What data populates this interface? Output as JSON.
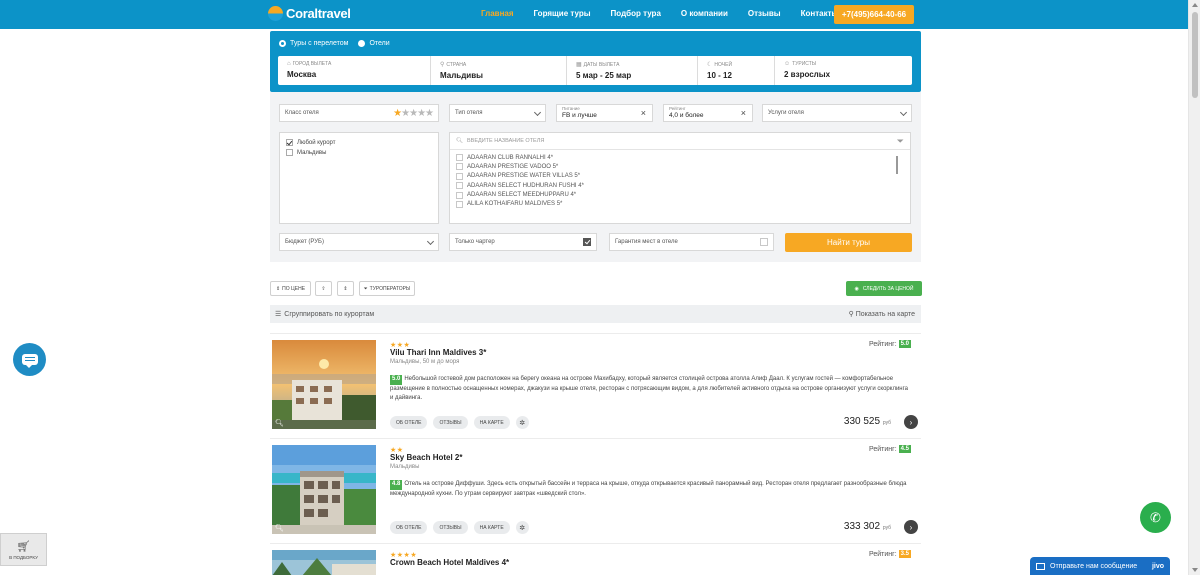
{
  "header": {
    "logo_text": "Coraltravel",
    "nav": [
      "Главная",
      "Горящие туры",
      "Подбор тура",
      "О компании",
      "Отзывы",
      "Контакты"
    ],
    "phone": "+7(495)664-40-66"
  },
  "search": {
    "tour_type_options": [
      "Туры с перелетом",
      "Отели"
    ],
    "fields": [
      {
        "caption": "Город вылета",
        "value": "Москва",
        "icon": "home-icon"
      },
      {
        "caption": "Страна",
        "value": "Мальдивы",
        "icon": "pin-icon"
      },
      {
        "caption": "Даты вылета",
        "value": "5 мар - 25 мар",
        "icon": "calendar-icon"
      },
      {
        "caption": "Ночей",
        "value": "10 - 12",
        "icon": "moon-icon"
      },
      {
        "caption": "Туристы",
        "value": "2 взрослых",
        "icon": "user-icon"
      }
    ]
  },
  "filters": {
    "hotel_class_label": "Класс отеля",
    "hotel_class_stars": 1,
    "hotel_type_label": "Тип отеля",
    "meal_caption": "Питание",
    "meal_value": "FB и лучше",
    "rating_caption": "Рейтинг",
    "rating_value": "4,0 и более",
    "services_label": "Услуги отеля",
    "resorts": [
      {
        "label": "Любой курорт",
        "checked": true
      },
      {
        "label": "Мальдивы",
        "checked": false
      }
    ],
    "hotel_search_placeholder": "ВВЕДИТЕ НАЗВАНИЕ ОТЕЛЯ",
    "hotels": [
      "ADAARAN CLUB RANNALHI 4*",
      "ADAARAN PRESTIGE VADOO 5*",
      "ADAARAN PRESTIGE WATER VILLAS 5*",
      "ADAARAN SELECT HUDHURAN FUSHI 4*",
      "ADAARAN SELECT MEEDHUPPARU 4*",
      "ALILA KOTHAIFARU MALDIVES 5*"
    ],
    "budget_label": "Бюджет (РУБ)",
    "charter_label": "Только чартер",
    "charter_checked": true,
    "guarantee_label": "Гарантия мест в отеле",
    "guarantee_checked": false,
    "find_button": "Найти туры"
  },
  "sort": {
    "by_price": "по цене",
    "operators": "туроператоры",
    "watch": "следить за ценой"
  },
  "group_bar": {
    "group_label": "Сгруппировать по курортам",
    "map_label": "Показать на карте"
  },
  "hotels": [
    {
      "stars": "★★★",
      "name": "Vilu Thari Inn Maldives 3*",
      "location": "Мальдивы, 50 м до моря",
      "score": "5.0",
      "description": "Небольшой гостевой дом расположен на берегу океана на острове Махибадху, который является столицей острова атолла Алиф Даал. К услугам гостей — комфортабельное размещение в полностью оснащенных номерах, джакузи на крыше отеля, ресторан с потрясающим видом, а для любителей активного отдыха на острове организуют услуги скорклинга и дайвинга.",
      "rating_label": "Рейтинг:",
      "rating": "5.0",
      "rating_color": "#4ab04f",
      "tags": [
        "об отеле",
        "отзывы",
        "на карте"
      ],
      "price": "330 525",
      "currency": "руб"
    },
    {
      "stars": "★★",
      "name": "Sky Beach Hotel 2*",
      "location": "Мальдивы",
      "score": "4.8",
      "description": "Отель на острове Диффуши. Здесь есть открытый бассейн и терраса на крыше, откуда открывается красивый панорамный вид. Ресторан отеля предлагает разнообразные блюда международной кухни. По утрам сервируют завтрак «шведский стол».",
      "rating_label": "Рейтинг:",
      "rating": "4.5",
      "rating_color": "#4ab04f",
      "tags": [
        "об отеле",
        "отзывы",
        "на карте"
      ],
      "price": "333 302",
      "currency": "руб"
    },
    {
      "stars": "★★★★",
      "name": "Crown Beach Hotel Maldives 4*",
      "location": "",
      "score": "",
      "description": "",
      "rating_label": "Рейтинг:",
      "rating": "3.5",
      "rating_color": "#f7a823",
      "tags": [],
      "price": "",
      "currency": ""
    }
  ],
  "widgets": {
    "cart_label": "в подборку",
    "message_label": "Отправьте нам сообщение",
    "jivo": "jivo"
  }
}
